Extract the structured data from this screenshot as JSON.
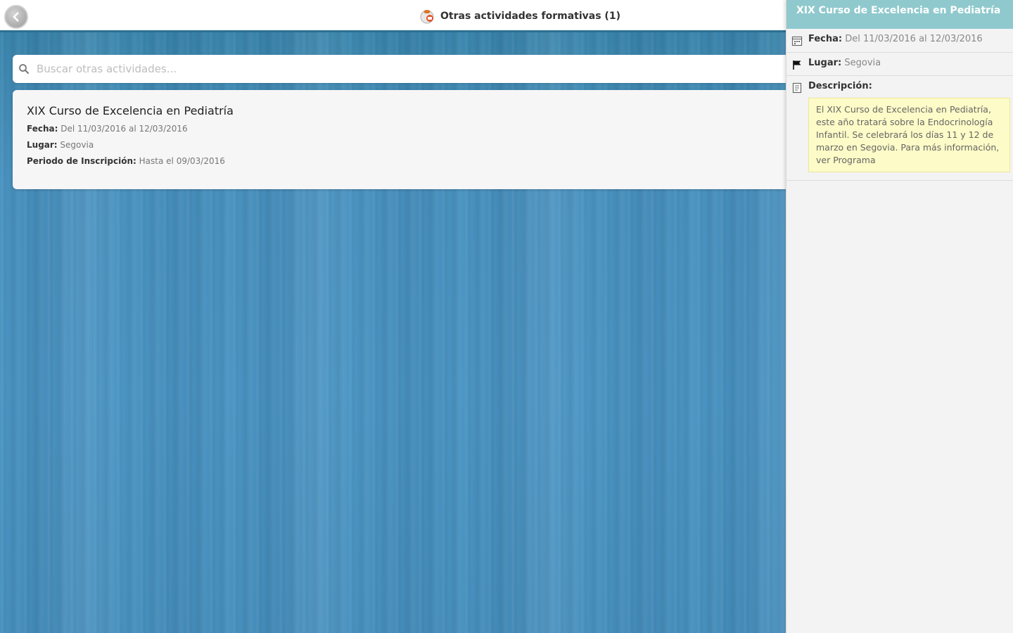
{
  "header": {
    "back_label": "",
    "title": "Otras actividades formativas (1)"
  },
  "search": {
    "placeholder": "Buscar otras actividades..."
  },
  "results": [
    {
      "title": "XIX Curso de Excelencia en Pediatría",
      "fecha_label": "Fecha:",
      "fecha_value": "Del 11/03/2016 al 12/03/2016",
      "lugar_label": "Lugar:",
      "lugar_value": "Segovia",
      "inscripcion_label": "Periodo de Inscripción:",
      "inscripcion_value": "Hasta el 09/03/2016"
    }
  ],
  "detail": {
    "title": "XIX Curso de Excelencia en Pediatría",
    "fecha_label": "Fecha:",
    "fecha_value": "Del 11/03/2016 al 12/03/2016",
    "lugar_label": "Lugar:",
    "lugar_value": "Segovia",
    "descripcion_label": "Descripción:",
    "descripcion_text": "El XIX Curso de Excelencia en Pediatría, este año tratará sobre la Endocrinología Infantil. Se celebrará los días 11 y 12 de marzo en Segovia. Para más información, ver Programa"
  },
  "icons": {
    "back": "back-arrow-icon",
    "logo": "app-logo-icon",
    "search": "search-icon",
    "fecha": "calendar-icon",
    "lugar": "flag-icon",
    "descripcion": "document-icon"
  },
  "colors": {
    "panel_header": "#8fc9cd",
    "topbar_border": "#2f6f93",
    "description_bg": "#fdfbc7"
  }
}
